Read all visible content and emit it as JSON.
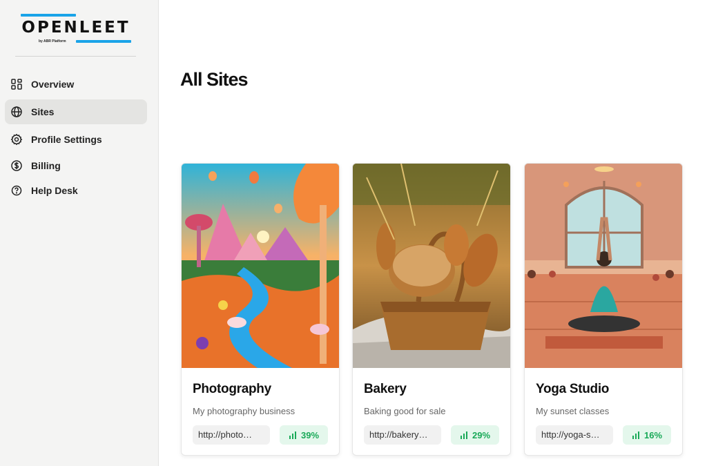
{
  "brand": {
    "name": "OPENLEET",
    "tagline": "by ABR Platform",
    "accent": "#1aa3e8"
  },
  "sidebar": {
    "items": [
      {
        "label": "Overview",
        "icon": "grid-icon",
        "active": false
      },
      {
        "label": "Sites",
        "icon": "globe-icon",
        "active": true
      },
      {
        "label": "Profile Settings",
        "icon": "gear-icon",
        "active": false
      },
      {
        "label": "Billing",
        "icon": "dollar-circle-icon",
        "active": false
      },
      {
        "label": "Help Desk",
        "icon": "help-circle-icon",
        "active": false
      }
    ]
  },
  "main": {
    "title": "All Sites",
    "sites": [
      {
        "name": "Photography",
        "description": "My photography business",
        "url": "http://photo…",
        "stat": "39%"
      },
      {
        "name": "Bakery",
        "description": "Baking good for sale",
        "url": "http://bakery…",
        "stat": "29%"
      },
      {
        "name": "Yoga Studio",
        "description": "My sunset classes",
        "url": "http://yoga-s…",
        "stat": "16%"
      }
    ]
  },
  "colors": {
    "stat_text": "#18a957",
    "stat_bg": "#e4f7ec",
    "sidebar_bg": "#f4f4f3",
    "active_bg": "#e4e4e2"
  }
}
